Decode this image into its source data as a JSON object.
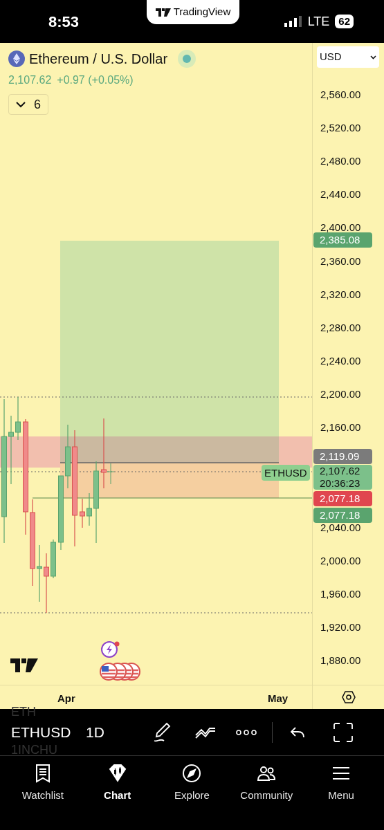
{
  "status_bar": {
    "time": "8:53",
    "app_name": "TradingView",
    "network": "LTE",
    "battery": "62"
  },
  "header": {
    "title": "Ethereum / U.S. Dollar",
    "price": "2,107.62",
    "change": "+0.97 (+0.05%)",
    "indicators_count": "6"
  },
  "currency_select": {
    "value": "USD"
  },
  "price_axis": {
    "ticks": [
      "2,560.00",
      "2,520.00",
      "2,480.00",
      "2,440.00",
      "2,400.00",
      "2,360.00",
      "2,320.00",
      "2,280.00",
      "2,240.00",
      "2,200.00",
      "2,160.00",
      "2,040.00",
      "2,000.00",
      "1,960.00",
      "1,920.00",
      "1,880.00"
    ]
  },
  "price_labels": [
    {
      "text": "2,385.08",
      "color": "#5aa46e"
    },
    {
      "text": "2,119.09",
      "color": "#7b7b7b"
    },
    {
      "text": "2,107.62",
      "sub": "20:36:23",
      "color": "#7cc08a"
    },
    {
      "text": "2,077.18",
      "color": "#e0464f"
    },
    {
      "text": "2,077.18",
      "color": "#5aa46e"
    }
  ],
  "symbol_tag": "ETHUSD",
  "time_axis": {
    "labels": [
      "Apr",
      "May"
    ]
  },
  "toolbar": {
    "symbol_above": "ETH",
    "symbol": "ETHUSD",
    "symbol_below": "1INCHU",
    "interval": "1D"
  },
  "tab_bar": {
    "items": [
      {
        "label": "Watchlist",
        "selected": false
      },
      {
        "label": "Chart",
        "selected": true
      },
      {
        "label": "Explore",
        "selected": false
      },
      {
        "label": "Community",
        "selected": false
      },
      {
        "label": "Menu",
        "selected": false
      }
    ]
  }
}
